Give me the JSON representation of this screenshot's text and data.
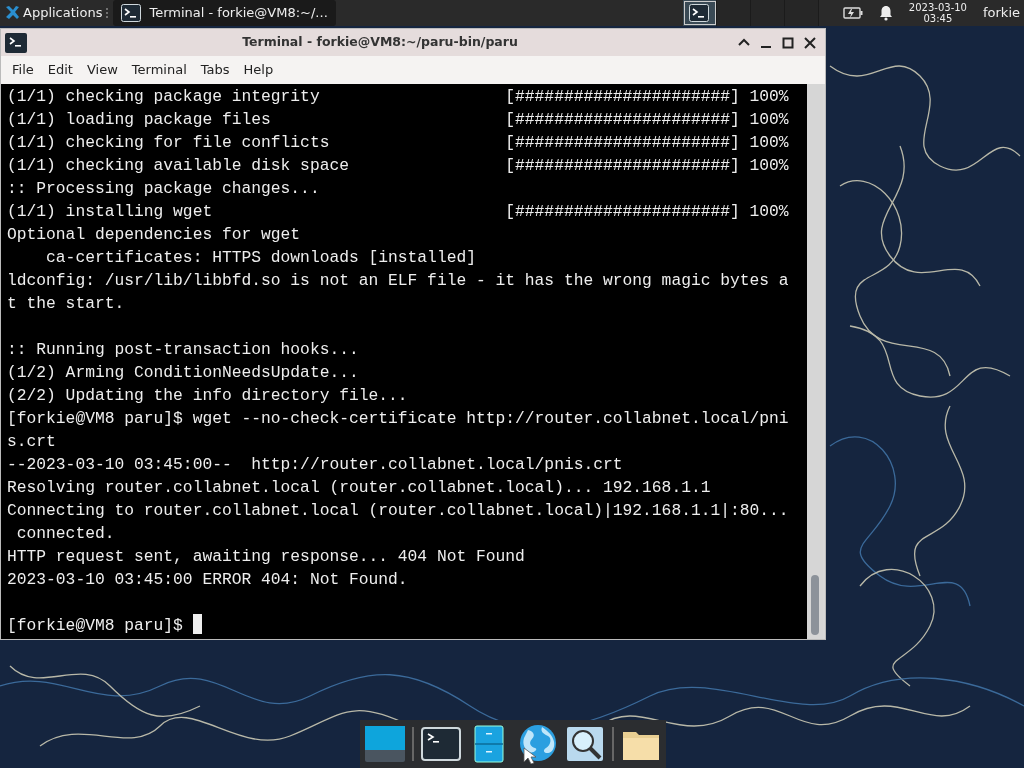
{
  "panel": {
    "applications_menu": "Applications",
    "tasks": [
      {
        "title": "Terminal - forkie@VM8:~/...",
        "selected": true
      }
    ],
    "workspaces": [
      {
        "selected": true
      },
      {
        "selected": false
      },
      {
        "selected": false
      },
      {
        "selected": false
      }
    ],
    "clock": {
      "date": "2023-03-10",
      "time": "03:45"
    },
    "user": "forkie"
  },
  "window": {
    "title": "Terminal - forkie@VM8:~/paru-bin/paru",
    "menu": [
      "File",
      "Edit",
      "View",
      "Terminal",
      "Tabs",
      "Help"
    ],
    "lines": [
      {
        "kind": "progress",
        "text": "(1/1) checking package integrity",
        "bar": "[######################]",
        "percent": "100%"
      },
      {
        "kind": "progress",
        "text": "(1/1) loading package files",
        "bar": "[######################]",
        "percent": "100%"
      },
      {
        "kind": "progress",
        "text": "(1/1) checking for file conflicts",
        "bar": "[######################]",
        "percent": "100%"
      },
      {
        "kind": "progress",
        "text": "(1/1) checking available disk space",
        "bar": "[######################]",
        "percent": "100%"
      },
      {
        "kind": "text",
        "text": ":: Processing package changes..."
      },
      {
        "kind": "progress",
        "text": "(1/1) installing wget",
        "bar": "[######################]",
        "percent": "100%"
      },
      {
        "kind": "text",
        "text": "Optional dependencies for wget"
      },
      {
        "kind": "text",
        "text": "    ca-certificates: HTTPS downloads [installed]"
      },
      {
        "kind": "text",
        "text": "ldconfig: /usr/lib/libbfd.so is not an ELF file - it has the wrong magic bytes a"
      },
      {
        "kind": "text",
        "text": "t the start."
      },
      {
        "kind": "blank"
      },
      {
        "kind": "text",
        "text": ":: Running post-transaction hooks..."
      },
      {
        "kind": "text",
        "text": "(1/2) Arming ConditionNeedsUpdate..."
      },
      {
        "kind": "text",
        "text": "(2/2) Updating the info directory file..."
      },
      {
        "kind": "text",
        "text": "[forkie@VM8 paru]$ wget --no-check-certificate http://router.collabnet.local/pni"
      },
      {
        "kind": "text",
        "text": "s.crt"
      },
      {
        "kind": "text",
        "text": "--2023-03-10 03:45:00--  http://router.collabnet.local/pnis.crt"
      },
      {
        "kind": "text",
        "text": "Resolving router.collabnet.local (router.collabnet.local)... 192.168.1.1"
      },
      {
        "kind": "text",
        "text": "Connecting to router.collabnet.local (router.collabnet.local)|192.168.1.1|:80..."
      },
      {
        "kind": "text",
        "text": " connected."
      },
      {
        "kind": "text",
        "text": "HTTP request sent, awaiting response... 404 Not Found"
      },
      {
        "kind": "text",
        "text": "2023-03-10 03:45:00 ERROR 404: Not Found."
      },
      {
        "kind": "blank"
      },
      {
        "kind": "prompt",
        "text": "[forkie@VM8 paru]$",
        "cursor": true
      }
    ]
  }
}
